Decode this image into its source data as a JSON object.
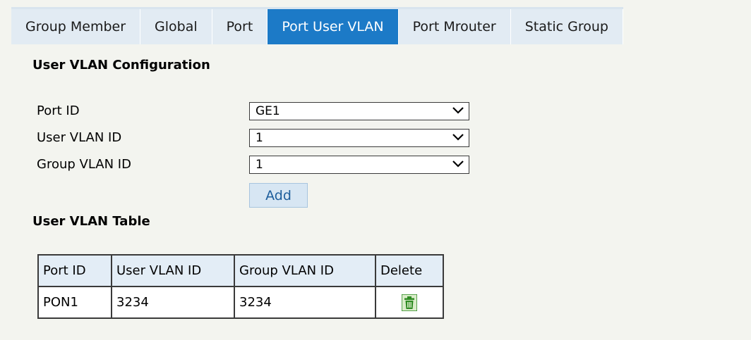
{
  "tabs": [
    {
      "label": "Group Member",
      "active": false
    },
    {
      "label": "Global",
      "active": false
    },
    {
      "label": "Port",
      "active": false
    },
    {
      "label": "Port User VLAN",
      "active": true
    },
    {
      "label": "Port Mrouter",
      "active": false
    },
    {
      "label": "Static Group",
      "active": false
    }
  ],
  "config": {
    "title": "User VLAN Configuration",
    "port_id_label": "Port ID",
    "port_id_value": "GE1",
    "user_vlan_label": "User VLAN ID",
    "user_vlan_value": "1",
    "group_vlan_label": "Group VLAN ID",
    "group_vlan_value": "1",
    "add_label": "Add"
  },
  "table": {
    "title": "User VLAN Table",
    "headers": [
      "Port ID",
      "User VLAN ID",
      "Group VLAN ID",
      "Delete"
    ],
    "rows": [
      {
        "port_id": "PON1",
        "user_vlan": "3234",
        "group_vlan": "3234",
        "delete_icon": "trash-icon"
      }
    ]
  },
  "colors": {
    "active_tab": "#1c7ac7",
    "inactive_tab": "#e2ebf3",
    "page_bg": "#f3f4ef",
    "header_bg": "#e3edf6",
    "delete_icon": "#2e8b22"
  }
}
